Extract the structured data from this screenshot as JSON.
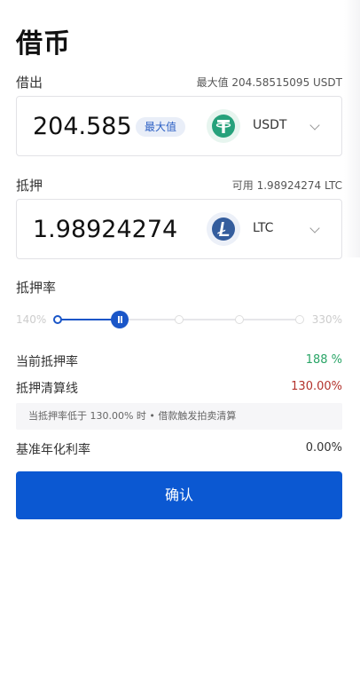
{
  "header": {
    "title": "借币"
  },
  "borrow": {
    "label": "借出",
    "max_text": "最大值  204.58515095  USDT",
    "value": "204.58515",
    "max_chip": "最大值",
    "coin": "USDT",
    "icon": "tether-icon"
  },
  "collateral": {
    "label": "抵押",
    "available_text": "可用  1.98924274  LTC",
    "value": "1.98924274",
    "coin": "LTC",
    "icon": "litecoin-icon"
  },
  "ratio": {
    "label": "抵押率",
    "min": "140%",
    "max": "330%",
    "level": 0.37
  },
  "stats": {
    "current_label": "当前抵押率",
    "current_value": "188 %",
    "liquidation_label": "抵押清算线",
    "liquidation_value": "130.00%",
    "note": "当抵押率低于  130.00%  时 • 借款触发拍卖清算",
    "rate_label": "基准年化利率",
    "rate_value": "0.00%"
  },
  "actions": {
    "confirm": "确认"
  },
  "colors": {
    "accent": "#0b58d2",
    "positive": "#2aa567",
    "negative": "#b3322c"
  }
}
